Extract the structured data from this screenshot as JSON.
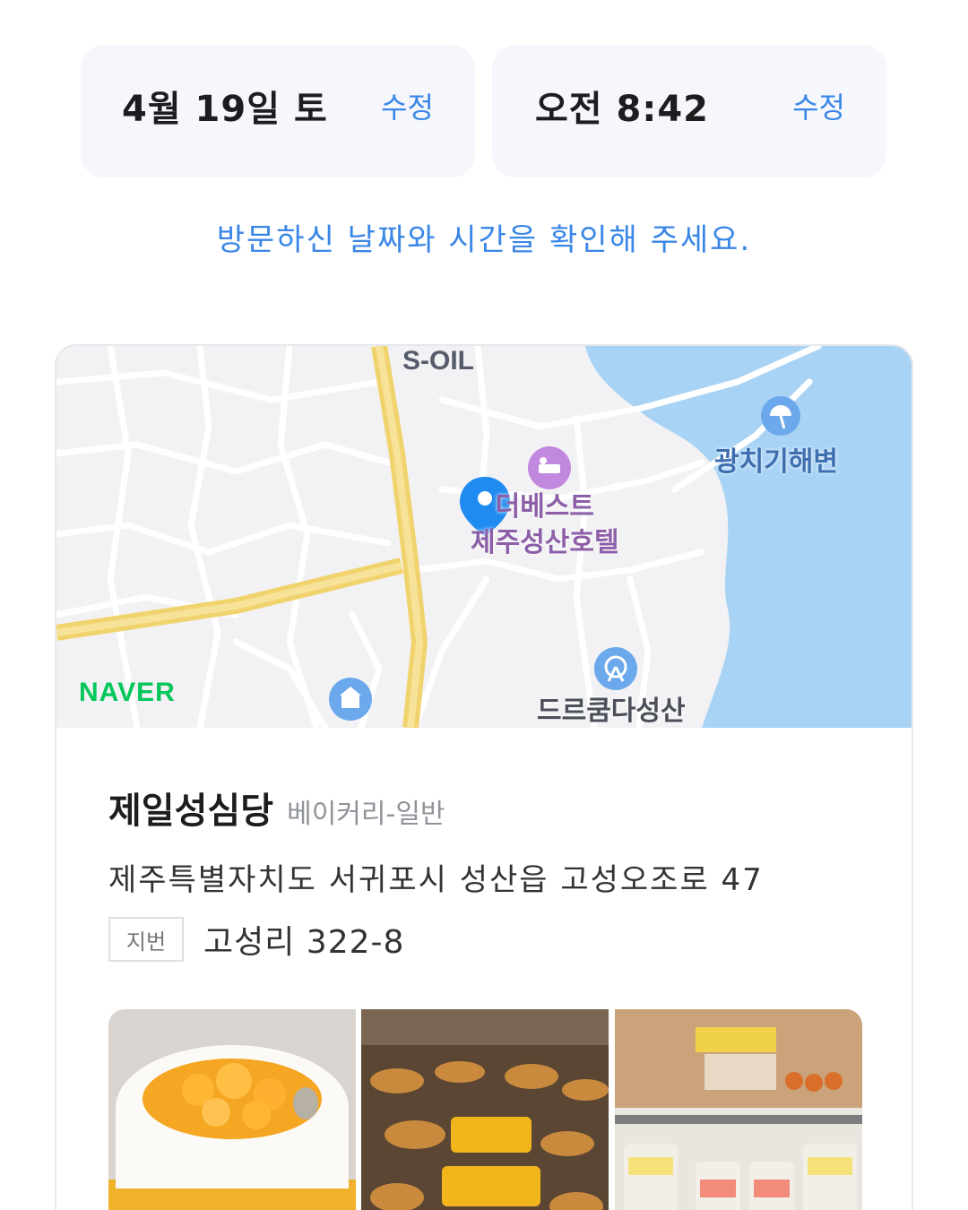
{
  "date_chip": {
    "value": "4월 19일 토",
    "edit_label": "수정"
  },
  "time_chip": {
    "value": "오전 8:42",
    "edit_label": "수정"
  },
  "notice": "방문하신 날짜와 시간을 확인해 주세요.",
  "map": {
    "labels": {
      "gas_station": "S-OIL",
      "beach": "광치기해변",
      "hotel_line1": "더베스트",
      "hotel_line2": "제주성산호텔",
      "attraction": "드르쿰다성산",
      "brand": "NAVER"
    }
  },
  "place": {
    "name": "제일성심당",
    "category": "베이커리-일반",
    "address": "제주특별자치도 서귀포시 성산읍 고성오조로 47",
    "jibun_label": "지번",
    "jibun": "고성리 322-8"
  },
  "colors": {
    "accent": "#3a86e6",
    "chip_bg": "#f5f7fc",
    "water": "#a8d3f5",
    "pin": "#1f8bf0",
    "naver": "#03c75a"
  },
  "icons": [
    "location-pin-icon",
    "hotel-icon",
    "beach-umbrella-icon",
    "ferris-wheel-icon",
    "building-icon"
  ]
}
